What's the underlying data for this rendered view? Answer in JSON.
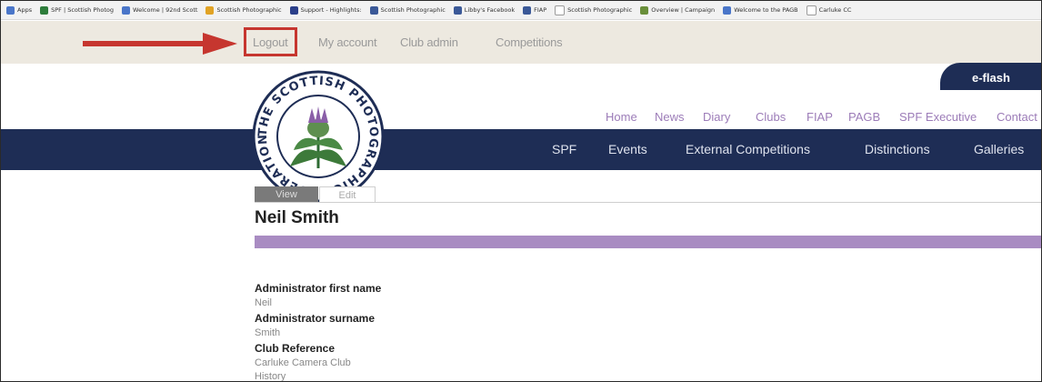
{
  "bookmarks": [
    {
      "label": "Apps",
      "color": "#4a76c9"
    },
    {
      "label": "SPF | Scottish Photog",
      "color": "#2e7d3b"
    },
    {
      "label": "Welcome | 92nd Scott",
      "color": "#4a76c9"
    },
    {
      "label": "Scottish Photographic",
      "color": "#e1a325"
    },
    {
      "label": "Support - Highlights:",
      "color": "#2b3f8a"
    },
    {
      "label": "Scottish Photographic",
      "color": "#3b5998"
    },
    {
      "label": "Libby's Facebook",
      "color": "#3b5998"
    },
    {
      "label": "FIAP",
      "color": "#3b5998"
    },
    {
      "label": "Scottish Photographic",
      "color": "#9b9b9b"
    },
    {
      "label": "Overview | Campaign",
      "color": "#6a8f3a"
    },
    {
      "label": "Welcome to the PAGB",
      "color": "#4a76c9"
    },
    {
      "label": "Carluke CC",
      "color": "#9b9b9b"
    }
  ],
  "toolbar": {
    "logout": "Logout",
    "my_account": "My account",
    "club_admin": "Club admin",
    "competitions": "Competitions"
  },
  "header": {
    "eflash": "e-flash",
    "logo_text": "THE SCOTTISH PHOTOGRAPHIC FEDERATION",
    "top_nav": [
      "Home",
      "News",
      "Diary",
      "Clubs",
      "FIAP",
      "PAGB",
      "SPF Executive",
      "Contact"
    ],
    "main_nav": [
      "SPF",
      "Events",
      "External Competitions",
      "Distinctions",
      "Galleries"
    ]
  },
  "content": {
    "tab_view": "View",
    "tab_edit": "Edit",
    "title": "Neil Smith",
    "fields": [
      {
        "label": "Administrator first name",
        "value": "Neil"
      },
      {
        "label": "Administrator surname",
        "value": "Smith"
      },
      {
        "label": "Club Reference",
        "value": "Carluke Camera Club"
      }
    ],
    "trailing_text": "History"
  },
  "colors": {
    "navy": "#1e2d55",
    "purple_accent": "#a98cc2",
    "link_purple": "#9c7cb8",
    "highlight_red": "#c6362f",
    "toolbar_bg": "#ede9e0"
  }
}
